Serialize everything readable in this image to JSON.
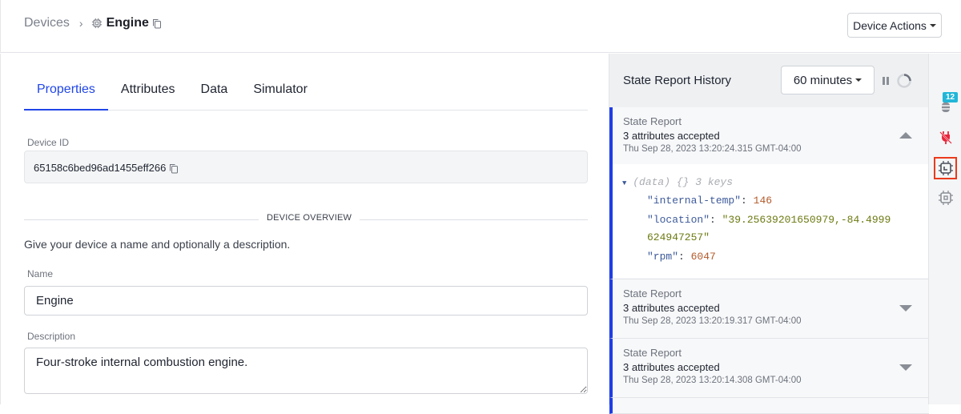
{
  "header": {
    "breadcrumb_root": "Devices",
    "breadcrumb_separator": "›",
    "device_name": "Engine",
    "actions_label": "Device Actions"
  },
  "tabs": [
    {
      "label": "Properties",
      "active": true
    },
    {
      "label": "Attributes",
      "active": false
    },
    {
      "label": "Data",
      "active": false
    },
    {
      "label": "Simulator",
      "active": false
    }
  ],
  "properties": {
    "device_id_label": "Device ID",
    "device_id": "65158c6bed96ad1455eff266",
    "section_title": "DEVICE OVERVIEW",
    "help_text": "Give your device a name and optionally a description.",
    "name_label": "Name",
    "name_value": "Engine",
    "description_label": "Description",
    "description_value": "Four-stroke internal combustion engine."
  },
  "state_history": {
    "title": "State Report History",
    "range": "60 minutes",
    "reports": [
      {
        "type": "State Report",
        "status": "3 attributes accepted",
        "time": "Thu Sep 28, 2023 13:20:24.315 GMT-04:00",
        "expanded": true,
        "data_summary": "(data) {} 3 keys",
        "data": [
          {
            "key": "\"internal-temp\"",
            "value": "146",
            "kind": "number"
          },
          {
            "key": "\"location\"",
            "value": "\"39.25639201650979,-84.4999",
            "value_cont": "624947257\"",
            "kind": "string"
          },
          {
            "key": "\"rpm\"",
            "value": "6047",
            "kind": "number"
          }
        ]
      },
      {
        "type": "State Report",
        "status": "3 attributes accepted",
        "time": "Thu Sep 28, 2023 13:20:19.317 GMT-04:00",
        "expanded": false
      },
      {
        "type": "State Report",
        "status": "3 attributes accepted",
        "time": "Thu Sep 28, 2023 13:20:14.308 GMT-04:00",
        "expanded": false
      }
    ]
  },
  "rail": {
    "debug_badge": "12",
    "accent": "#ea3a1c",
    "badge_color": "#21b6d8"
  },
  "colors": {
    "primary": "#2046e8",
    "report_bar": "#1f3ee6"
  }
}
